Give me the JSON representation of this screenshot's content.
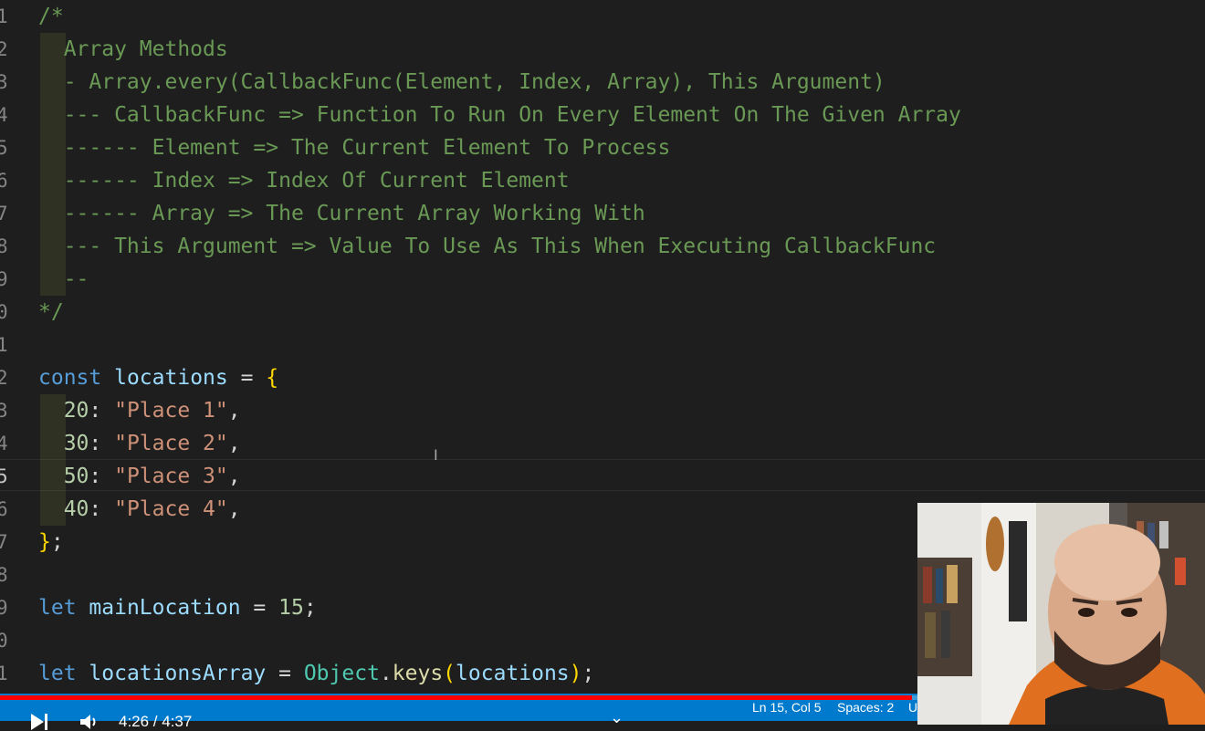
{
  "editor": {
    "line_numbers": [
      "1",
      "2",
      "3",
      "4",
      "5",
      "6",
      "7",
      "8",
      "9",
      "0",
      "1",
      "2",
      "3",
      "4",
      "5",
      "6",
      "7",
      "8",
      "9",
      "0",
      "1"
    ],
    "active_line_index": 14,
    "lines": [
      {
        "segs": [
          {
            "t": "/*",
            "c": "c"
          }
        ]
      },
      {
        "segs": [
          {
            "t": "  Array Methods",
            "c": "c"
          }
        ]
      },
      {
        "segs": [
          {
            "t": "  - Array.every(CallbackFunc(Element, Index, Array), This Argument)",
            "c": "c"
          }
        ]
      },
      {
        "segs": [
          {
            "t": "  --- CallbackFunc => Function To Run On Every Element On The Given Array",
            "c": "c"
          }
        ]
      },
      {
        "segs": [
          {
            "t": "  ------ Element => The Current Element To Process",
            "c": "c"
          }
        ]
      },
      {
        "segs": [
          {
            "t": "  ------ Index => Index Of Current Element",
            "c": "c"
          }
        ]
      },
      {
        "segs": [
          {
            "t": "  ------ Array => The Current Array Working With",
            "c": "c"
          }
        ]
      },
      {
        "segs": [
          {
            "t": "  --- This Argument => Value To Use As This When Executing CallbackFunc",
            "c": "c"
          }
        ]
      },
      {
        "segs": [
          {
            "t": "  --",
            "c": "c"
          }
        ]
      },
      {
        "segs": [
          {
            "t": "*/",
            "c": "c"
          }
        ]
      },
      {
        "segs": []
      },
      {
        "segs": [
          {
            "t": "const",
            "c": "kw"
          },
          {
            "t": " ",
            "c": "prop"
          },
          {
            "t": "locations",
            "c": "var"
          },
          {
            "t": " = ",
            "c": "prop"
          },
          {
            "t": "{",
            "c": "br"
          }
        ]
      },
      {
        "segs": [
          {
            "t": "  ",
            "c": "prop"
          },
          {
            "t": "20",
            "c": "num"
          },
          {
            "t": ": ",
            "c": "prop"
          },
          {
            "t": "\"Place 1\"",
            "c": "str"
          },
          {
            "t": ",",
            "c": "prop"
          }
        ]
      },
      {
        "segs": [
          {
            "t": "  ",
            "c": "prop"
          },
          {
            "t": "30",
            "c": "num"
          },
          {
            "t": ": ",
            "c": "prop"
          },
          {
            "t": "\"Place 2\"",
            "c": "str"
          },
          {
            "t": ",",
            "c": "prop"
          }
        ]
      },
      {
        "segs": [
          {
            "t": "  ",
            "c": "prop"
          },
          {
            "t": "50",
            "c": "num"
          },
          {
            "t": ": ",
            "c": "prop"
          },
          {
            "t": "\"Place 3\"",
            "c": "str"
          },
          {
            "t": ",",
            "c": "prop"
          }
        ]
      },
      {
        "segs": [
          {
            "t": "  ",
            "c": "prop"
          },
          {
            "t": "40",
            "c": "num"
          },
          {
            "t": ": ",
            "c": "prop"
          },
          {
            "t": "\"Place 4\"",
            "c": "str"
          },
          {
            "t": ",",
            "c": "prop"
          }
        ]
      },
      {
        "segs": [
          {
            "t": "}",
            "c": "br"
          },
          {
            "t": ";",
            "c": "prop"
          }
        ]
      },
      {
        "segs": []
      },
      {
        "segs": [
          {
            "t": "let",
            "c": "kw"
          },
          {
            "t": " ",
            "c": "prop"
          },
          {
            "t": "mainLocation",
            "c": "var"
          },
          {
            "t": " = ",
            "c": "prop"
          },
          {
            "t": "15",
            "c": "num"
          },
          {
            "t": ";",
            "c": "prop"
          }
        ]
      },
      {
        "segs": []
      },
      {
        "segs": [
          {
            "t": "let",
            "c": "kw"
          },
          {
            "t": " ",
            "c": "prop"
          },
          {
            "t": "locationsArray",
            "c": "var"
          },
          {
            "t": " = ",
            "c": "prop"
          },
          {
            "t": "Object",
            "c": "cls"
          },
          {
            "t": ".",
            "c": "prop"
          },
          {
            "t": "keys",
            "c": "fn"
          },
          {
            "t": "(",
            "c": "br"
          },
          {
            "t": "locations",
            "c": "var"
          },
          {
            "t": ")",
            "c": "br"
          },
          {
            "t": ";",
            "c": "prop"
          }
        ]
      }
    ]
  },
  "statusbar": {
    "position": "Ln 15, Col 5",
    "spaces": "Spaces: 2",
    "encoding": "U"
  },
  "player": {
    "time": "4:26 / 4:37",
    "progress_fraction": 0.757,
    "icons": [
      "play-icon",
      "next-icon",
      "volume-icon",
      "chevron-down-icon"
    ]
  },
  "colors": {
    "background": "#1e1e1e",
    "comment": "#6a9955",
    "keyword": "#569cd6",
    "variable": "#9cdcfe",
    "string": "#ce9178",
    "number": "#b5cea8",
    "bracket": "#ffd700",
    "statusbar": "#007acc",
    "progress": "#ff0000"
  }
}
